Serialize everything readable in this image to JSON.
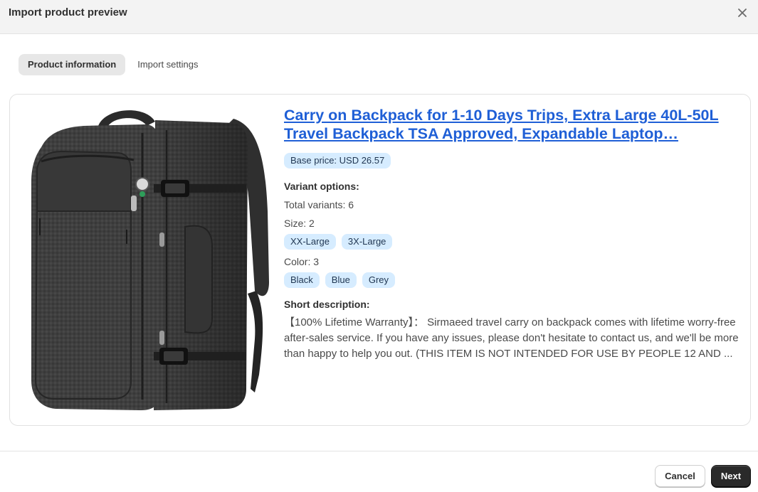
{
  "dialog": {
    "title": "Import product preview",
    "close_icon": "close-icon"
  },
  "tabs": [
    {
      "label": "Product information",
      "active": true
    },
    {
      "label": "Import settings",
      "active": false
    }
  ],
  "product": {
    "image_alt": "backpack-image",
    "title": "Carry on Backpack for 1-10 Days Trips, Extra Large 40L-50L Travel Backpack TSA Approved, Expandable Laptop…",
    "base_price": "Base price: USD 26.57",
    "variant_options_label": "Variant options:",
    "total_variants": "Total variants: 6",
    "size_label": "Size: 2",
    "sizes": [
      "XX-Large",
      "3X-Large"
    ],
    "color_label": "Color: 3",
    "colors": [
      "Black",
      "Blue",
      "Grey"
    ],
    "short_description_label": "Short description:",
    "short_description": "【100% Lifetime Warranty】： Sirmaeed travel carry on backpack comes with lifetime worry-free after-sales service. If you have any issues, please don't hesitate to contact us, and we'll be more than happy to help you out. (THIS ITEM IS NOT INTENDED FOR USE BY PEOPLE 12 AND ..."
  },
  "footer": {
    "cancel_label": "Cancel",
    "next_label": "Next"
  },
  "colors": {
    "link": "#1f5fd6",
    "badge_bg": "#d6ecff",
    "primary_button": "#2a2a2a"
  }
}
